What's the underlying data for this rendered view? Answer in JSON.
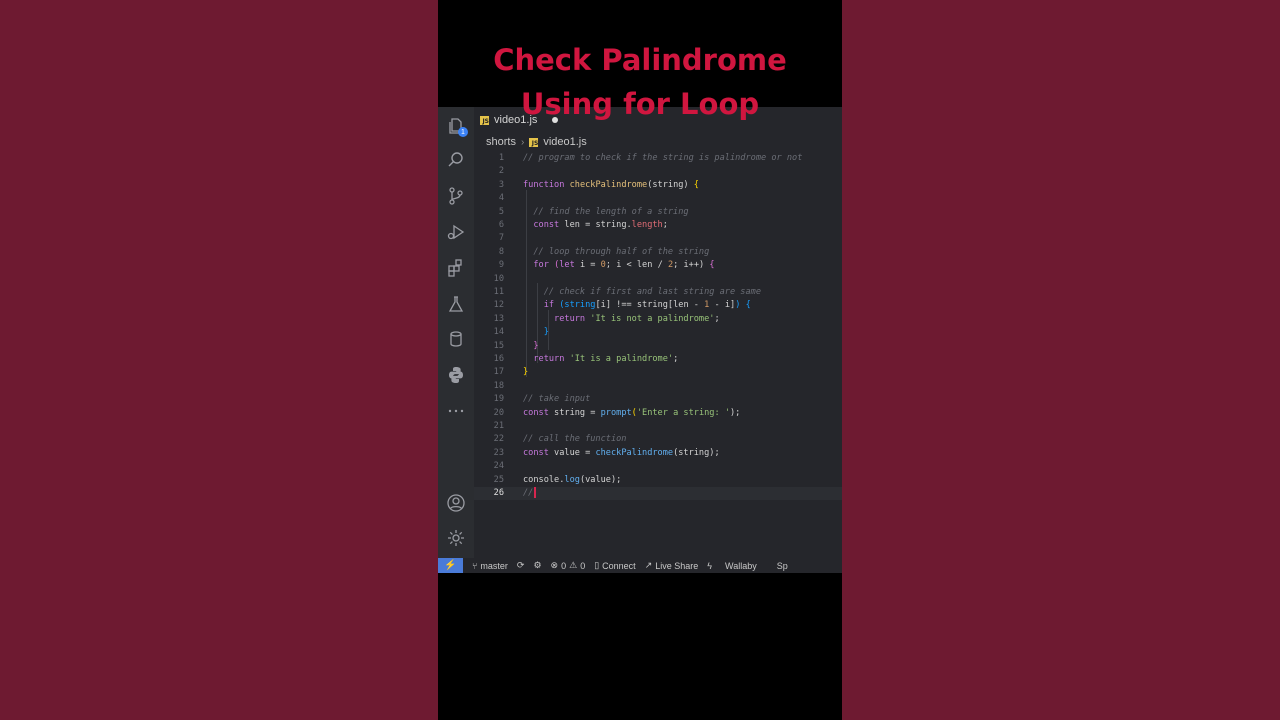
{
  "overlay": {
    "title_line1": "Check Palindrome",
    "title_line2": "Using for Loop"
  },
  "colors": {
    "background": "#6e1a31",
    "title": "#d0163f",
    "editor_bg": "#25262b",
    "remote_button": "#4a7bd8"
  },
  "activity_bar": {
    "explorer_badge": "1",
    "icons": [
      "files-icon",
      "search-icon",
      "source-control-icon",
      "run-debug-icon",
      "extensions-icon",
      "testing-icon",
      "database-icon",
      "python-icon",
      "more-icon",
      "account-icon",
      "gear-icon"
    ]
  },
  "tab": {
    "label": "video1.js",
    "file_icon": "JS"
  },
  "breadcrumb": {
    "folder": "shorts",
    "file": "video1.js"
  },
  "editor": {
    "active_line": 26,
    "lines": [
      {
        "n": "1"
      },
      {
        "n": "2"
      },
      {
        "n": "3"
      },
      {
        "n": "4"
      },
      {
        "n": "5"
      },
      {
        "n": "6"
      },
      {
        "n": "7"
      },
      {
        "n": "8"
      },
      {
        "n": "9"
      },
      {
        "n": "10"
      },
      {
        "n": "11"
      },
      {
        "n": "12"
      },
      {
        "n": "13"
      },
      {
        "n": "14"
      },
      {
        "n": "15"
      },
      {
        "n": "16"
      },
      {
        "n": "17"
      },
      {
        "n": "18"
      },
      {
        "n": "19"
      },
      {
        "n": "20"
      },
      {
        "n": "21"
      },
      {
        "n": "22"
      },
      {
        "n": "23"
      },
      {
        "n": "24"
      },
      {
        "n": "25"
      },
      {
        "n": "26"
      }
    ],
    "tokens": {
      "l1_comment": "// program to check if the string is palindrome or not",
      "l3_kw": "function",
      "l3_fn": "checkPalindrome",
      "l3_param": "(string) ",
      "l3_brace": "{",
      "l5_comment": "// find the length of a string",
      "l6_kw": "const",
      "l6_rest": " len = string.",
      "l6_prop": "length",
      "l6_end": ";",
      "l8_comment": "// loop through half of the string",
      "l9_kw": "for",
      "l9_open": " (",
      "l9_let": "let",
      "l9_a": " i = ",
      "l9_zero": "0",
      "l9_b": "; i < len / ",
      "l9_two": "2",
      "l9_c": "; i++) ",
      "l9_brace": "{",
      "l11_comment": "// check if first and last string are same",
      "l12_kw": "if",
      "l12_a": " (string",
      "l12_b": "[i]",
      "l12_c": " !== string",
      "l12_d": "[len - ",
      "l12_one": "1",
      "l12_e": " - i]",
      "l12_f": ") ",
      "l12_brace": "{",
      "l13_kw": "return",
      "l13_str": "'It is not a palindrome'",
      "l13_end": ";",
      "l14_brace": "}",
      "l15_brace": "}",
      "l16_kw": "return",
      "l16_str": "'It is a palindrome'",
      "l16_end": ";",
      "l17_brace": "}",
      "l19_comment": "// take input",
      "l20_kw": "const",
      "l20_a": " string = ",
      "l20_fn": "prompt",
      "l20_open": "(",
      "l20_str": "'Enter a string: '",
      "l20_end": ");",
      "l22_comment": "// call the function",
      "l23_kw": "const",
      "l23_a": " value = ",
      "l23_fn": "checkPalindrome",
      "l23_b": "(string);",
      "l25_a": "console.",
      "l25_fn": "log",
      "l25_b": "(value);",
      "l26_comment": "//"
    }
  },
  "status_bar": {
    "branch": "master",
    "errors": "0",
    "warnings": "0",
    "connect": "Connect",
    "live_share": "Live Share",
    "wallaby": "Wallaby",
    "truncated": "Sp"
  }
}
